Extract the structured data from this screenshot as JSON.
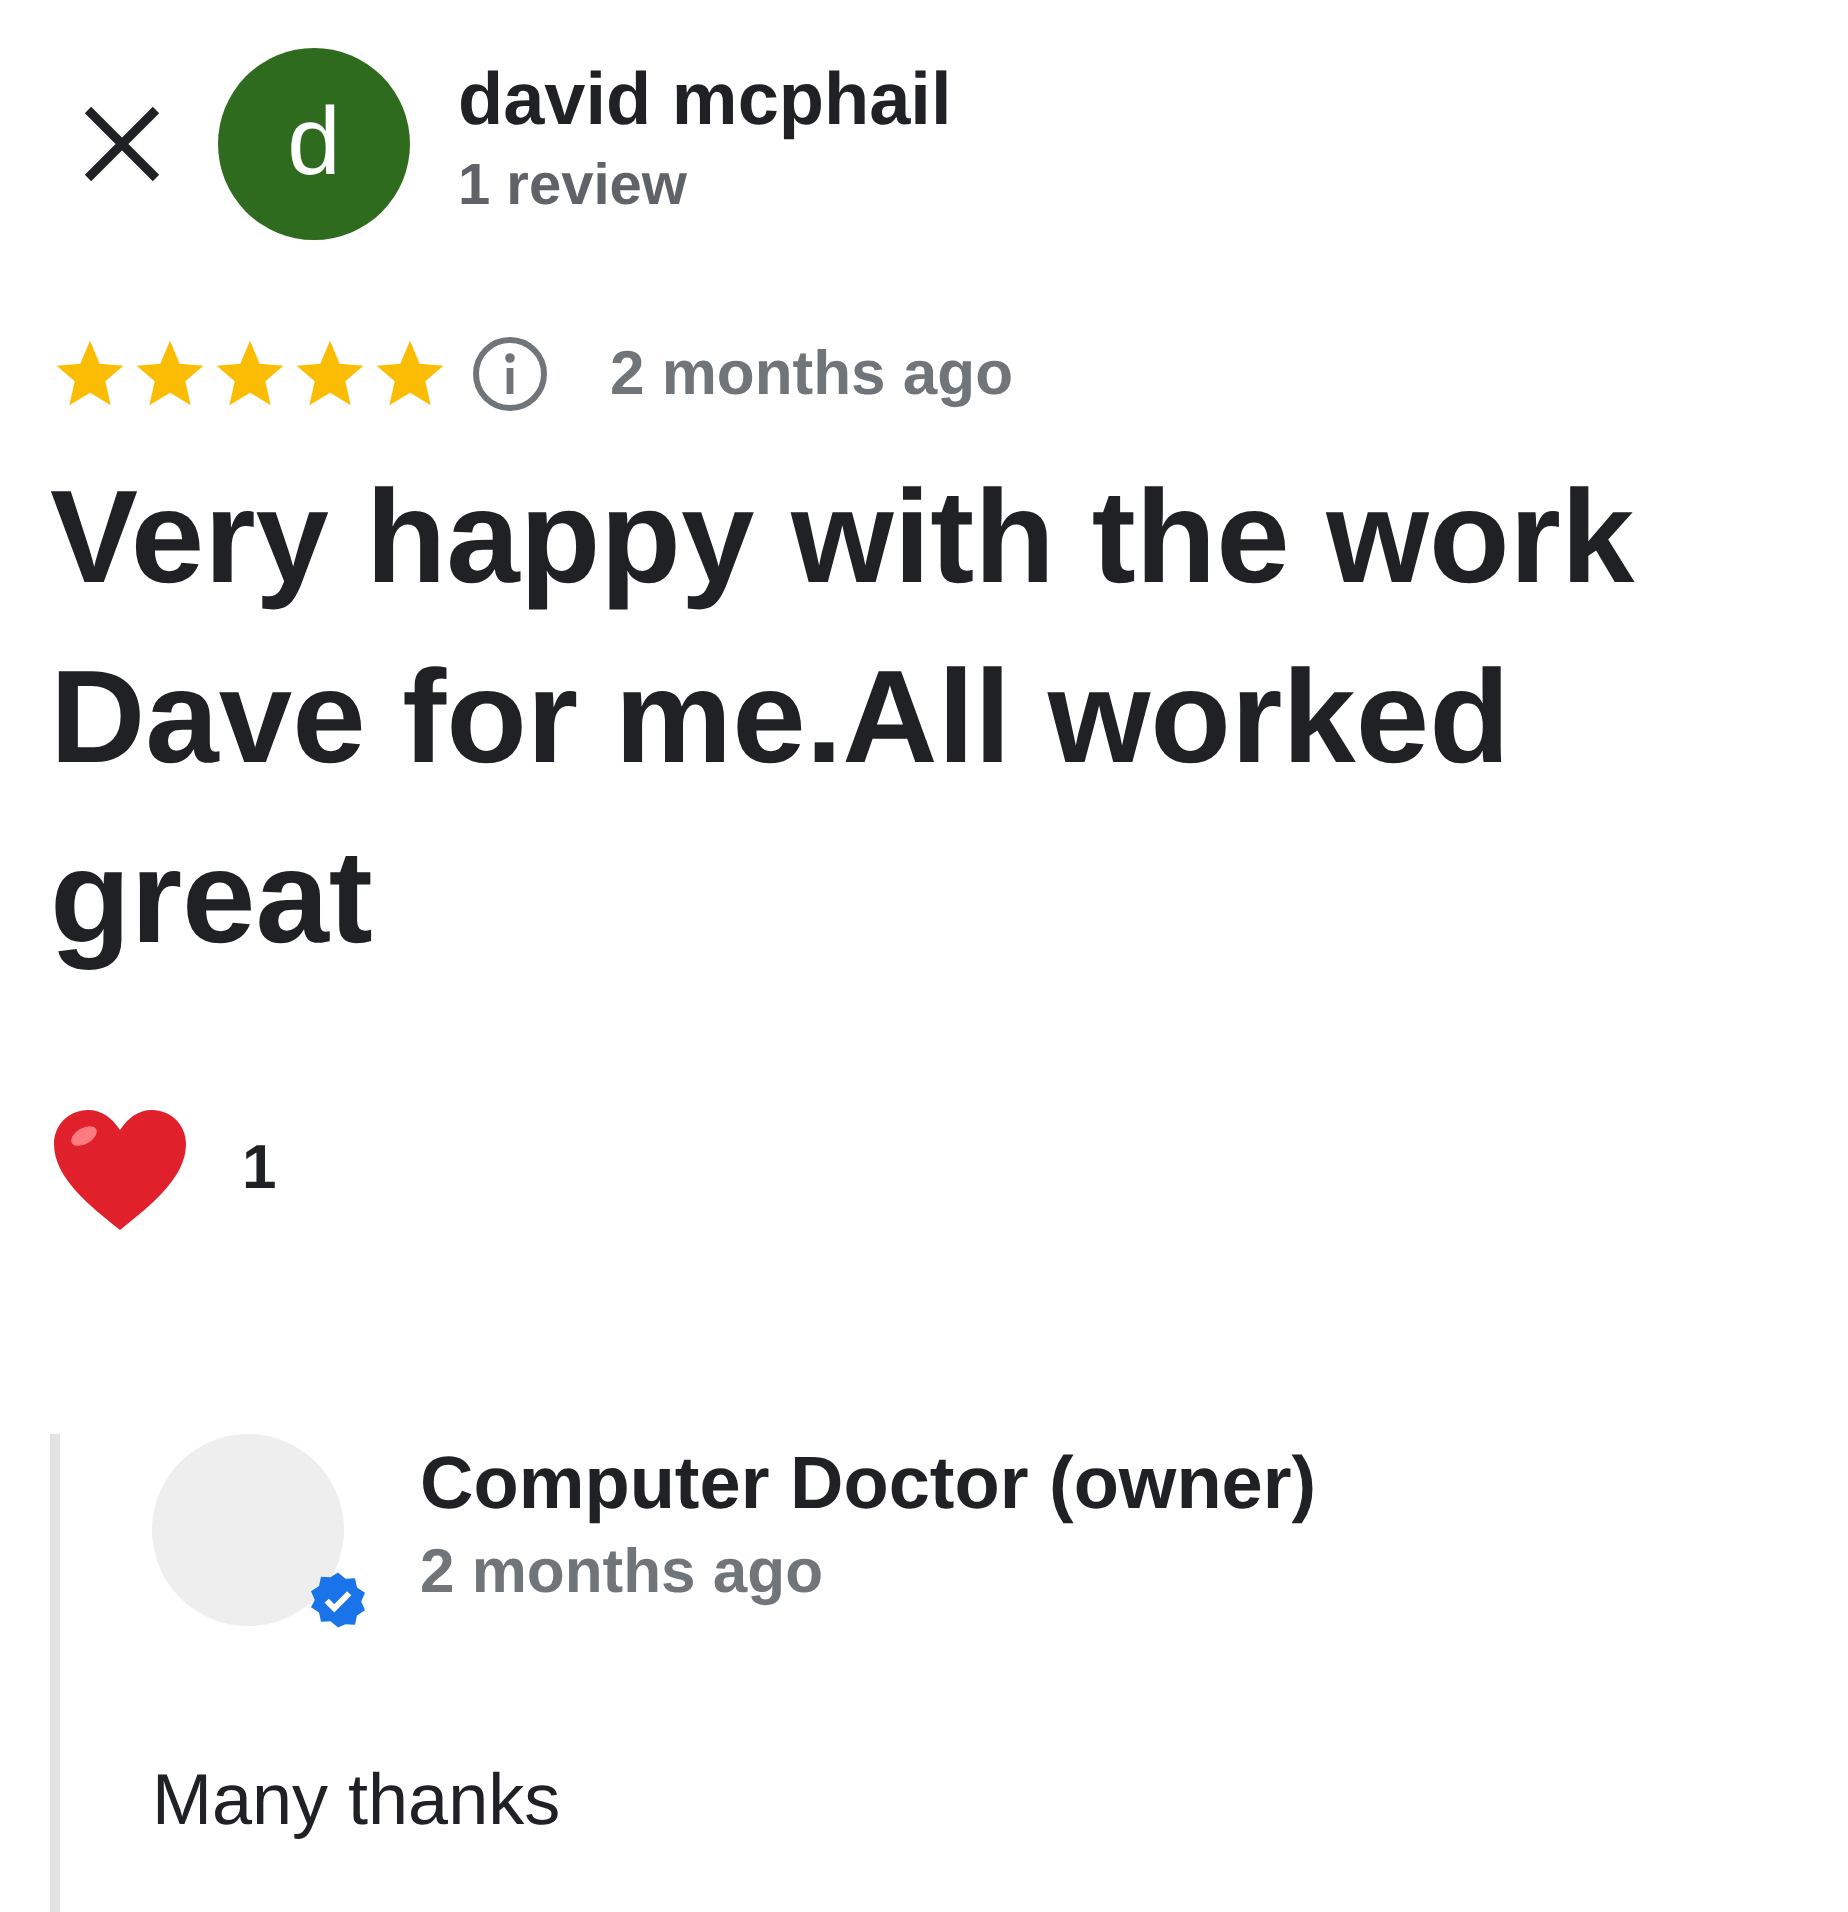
{
  "reviewer": {
    "avatar_letter": "d",
    "name": "david mcphail",
    "review_count": "1 review"
  },
  "review": {
    "stars": 5,
    "time": "2 months ago",
    "text": "Very happy with the work Dave for me.All worked great",
    "reaction_count": "1"
  },
  "owner_reply": {
    "name": "Computer Doctor (owner)",
    "verified": true,
    "time": "2 months ago",
    "text": "Many thanks"
  }
}
